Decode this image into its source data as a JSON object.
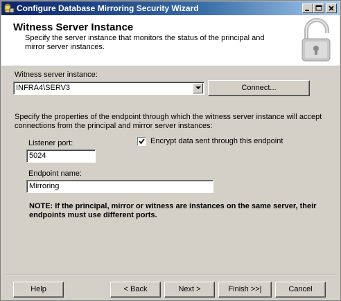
{
  "window": {
    "title": "Configure Database Mirroring Security Wizard"
  },
  "header": {
    "title": "Witness Server Instance",
    "description": "Specify the server instance that monitors the status of the principal and mirror server instances.",
    "icon": "lock-icon"
  },
  "witness": {
    "label": "Witness server instance:",
    "value": "INFRA4\\SERV3",
    "connect_label": "Connect..."
  },
  "endpoint": {
    "intro": "Specify the properties of the endpoint through which the witness server instance will accept connections from the principal and mirror server instances:",
    "port_label": "Listener port:",
    "port_value": "5024",
    "encrypt_label": "Encrypt data sent through this endpoint",
    "encrypt_checked": true,
    "name_label": "Endpoint name:",
    "name_value": "Mirroring"
  },
  "note": "NOTE: If the principal, mirror or witness are instances on the same server, their endpoints must use different ports.",
  "footer": {
    "help": "Help",
    "back": "< Back",
    "next": "Next >",
    "finish": "Finish >>|",
    "cancel": "Cancel"
  }
}
